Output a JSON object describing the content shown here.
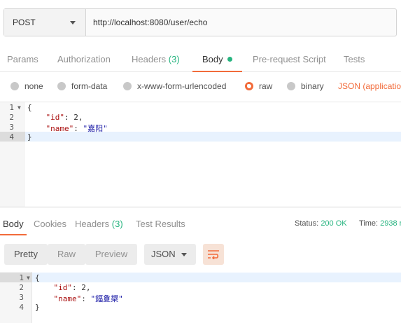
{
  "request": {
    "method": "POST",
    "url": "http://localhost:8080/user/echo"
  },
  "tabs": {
    "params": "Params",
    "authorization": "Authorization",
    "headers": "Headers",
    "headers_count": "(3)",
    "body": "Body",
    "prerequest": "Pre-request Script",
    "tests": "Tests"
  },
  "body_types": {
    "none": "none",
    "form_data": "form-data",
    "urlencoded": "x-www-form-urlencoded",
    "raw": "raw",
    "binary": "binary",
    "format": "JSON (applicatio"
  },
  "request_body": {
    "line_numbers": [
      "1",
      "2",
      "3",
      "4"
    ],
    "open_brace": "{",
    "id_key": "\"id\"",
    "id_value": "2",
    "name_key": "\"name\"",
    "name_value": "\"嘉阳\"",
    "close_brace": "}"
  },
  "response": {
    "tabs": {
      "body": "Body",
      "cookies": "Cookies",
      "headers": "Headers",
      "headers_count": "(3)",
      "test_results": "Test Results"
    },
    "status_label": "Status:",
    "status_value": "200 OK",
    "time_label": "Time:",
    "time_value": "2938 r",
    "view_modes": {
      "pretty": "Pretty",
      "raw": "Raw",
      "preview": "Preview"
    },
    "format": "JSON",
    "line_numbers": [
      "1",
      "2",
      "3",
      "4"
    ],
    "open_brace": "{",
    "id_key": "\"id\"",
    "id_value": "2",
    "name_key": "\"name\"",
    "name_value": "\"鍢夐槼\"",
    "close_brace": "}"
  },
  "colors": {
    "accent": "#f26b3a",
    "success": "#26b47f"
  }
}
